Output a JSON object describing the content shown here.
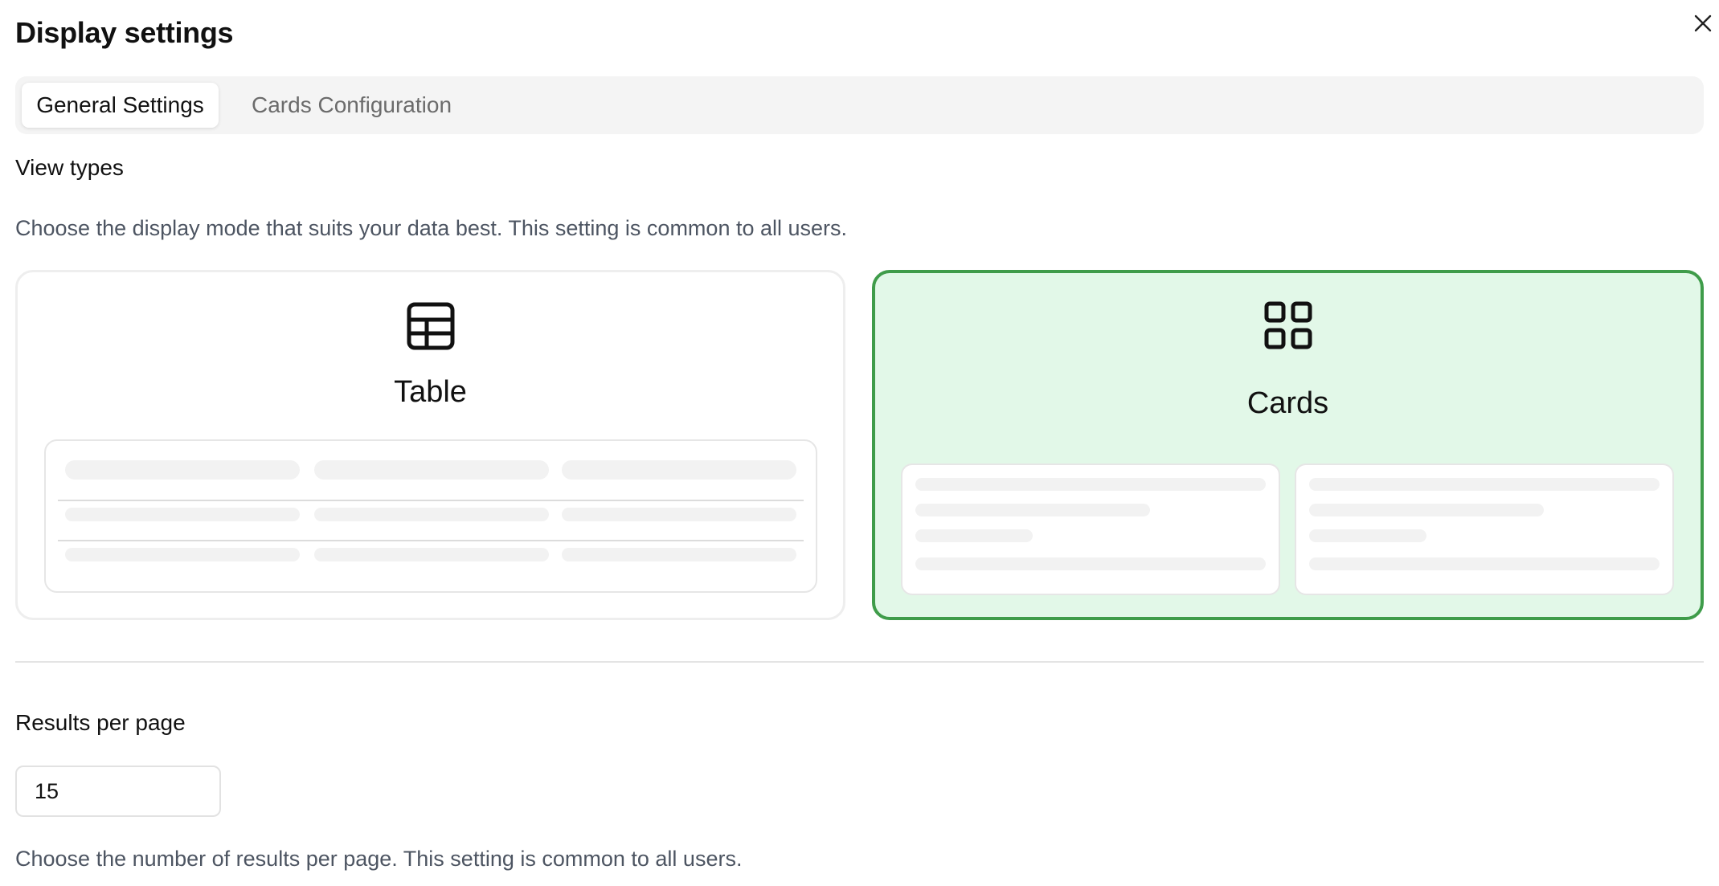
{
  "dialog": {
    "title": "Display settings",
    "close_icon": "close-icon"
  },
  "tabs": [
    {
      "label": "General Settings",
      "active": true
    },
    {
      "label": "Cards Configuration",
      "active": false
    }
  ],
  "view_types": {
    "heading": "View types",
    "description": "Choose the display mode that suits your data best. This setting is common to all users.",
    "options": [
      {
        "label": "Table",
        "icon": "table-icon",
        "selected": false
      },
      {
        "label": "Cards",
        "icon": "grid-icon",
        "selected": true
      }
    ],
    "selected_accent": "#3f9c4a",
    "selected_background": "#e2f8e8"
  },
  "results_per_page": {
    "heading": "Results per page",
    "value": "15",
    "description": "Choose the number of results per page. This setting is common to all users."
  }
}
